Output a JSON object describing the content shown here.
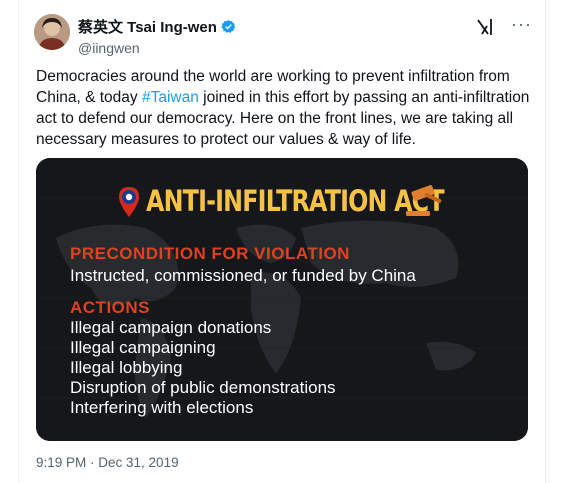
{
  "author": {
    "display_name": "蔡英文 Tsai Ing-wen",
    "handle": "@iingwen"
  },
  "tweet": {
    "text_before": "Democracies around the world are working to prevent infiltration from China, & today ",
    "hashtag": "#Taiwan",
    "text_after": " joined in this effort by passing an anti-infiltration act to defend our democracy. Here on the front lines, we are taking all necessary measures to protect our values & way of life.",
    "timestamp": "9:19 PM · Dec 31, 2019"
  },
  "card": {
    "title": "ANTI-INFILTRATION ACT",
    "precondition_heading": "PRECONDITION FOR VIOLATION",
    "precondition_text": "Instructed, commissioned, or funded by China",
    "actions_heading": "ACTIONS",
    "actions": [
      "Illegal campaign donations",
      "Illegal campaigning",
      "Illegal lobbying",
      "Disruption of public demonstrations",
      "Interfering with elections"
    ]
  },
  "icons": {
    "verified": "verified-badge-icon",
    "grok": "grok-icon",
    "more": "more-icon",
    "pin": "taiwan-flag-pin-icon",
    "gavel": "gavel-icon"
  },
  "colors": {
    "hashtag": "#1d9bf0",
    "card_title": "#f6c243",
    "card_heading": "#e0411f",
    "verified": "#1d9bf0"
  }
}
